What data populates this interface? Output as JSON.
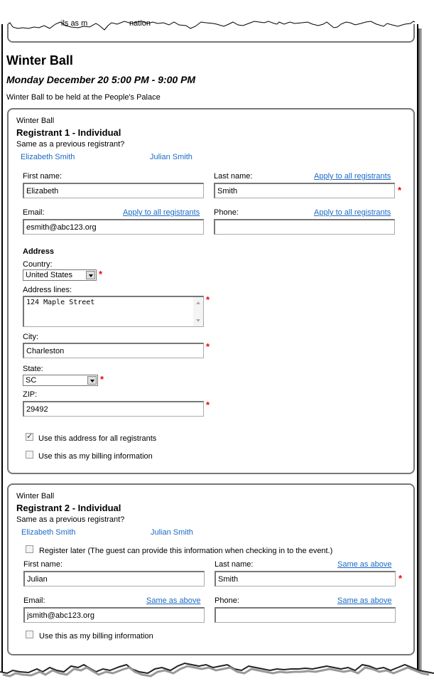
{
  "prev_fragment": {
    "text_a": "ils as m",
    "text_b": "nation"
  },
  "event": {
    "title": "Winter Ball",
    "datetime": "Monday  December 20 5:00 PM - 9:00 PM",
    "description": "Winter Ball to be held at the People's Palace"
  },
  "registrant1": {
    "event_name": "Winter Ball",
    "heading": "Registrant 1 - Individual",
    "same_prompt": "Same as a previous registrant?",
    "prev_links": [
      "Elizabeth Smith",
      "Julian Smith"
    ],
    "first_name_label": "First name:",
    "first_name_value": "Elizabeth",
    "last_name_label": "Last name:",
    "last_name_link": "Apply to all registrants",
    "last_name_value": "Smith",
    "email_label": "Email:",
    "email_link": "Apply to all registrants",
    "email_value": "esmith@abc123.org",
    "phone_label": "Phone:",
    "phone_link": "Apply to all registrants",
    "phone_value": "",
    "address_heading": "Address",
    "country_label": "Country:",
    "country_value": "United States",
    "address_lines_label": "Address lines:",
    "address_lines_value": "124 Maple Street",
    "city_label": "City:",
    "city_value": "Charleston",
    "state_label": "State:",
    "state_value": "SC",
    "zip_label": "ZIP:",
    "zip_value": "29492",
    "use_address_all": {
      "label": "Use this address for all registrants",
      "checked": true
    },
    "use_billing": {
      "label": "Use this as my billing information",
      "checked": false
    },
    "required_mark": "*"
  },
  "registrant2": {
    "event_name": "Winter Ball",
    "heading": "Registrant 2 - Individual",
    "same_prompt": "Same as a previous registrant?",
    "prev_links": [
      "Elizabeth Smith",
      "Julian Smith"
    ],
    "register_later": {
      "label": "Register later (The guest can provide this information when checking in to the event.)",
      "checked": false
    },
    "first_name_label": "First name:",
    "first_name_value": "Julian",
    "last_name_label": "Last name:",
    "last_name_link": "Same as above",
    "last_name_value": "Smith",
    "email_label": "Email:",
    "email_link": "Same as above",
    "email_value": "jsmith@abc123.org",
    "phone_label": "Phone:",
    "phone_link": "Same as above",
    "phone_value": "",
    "use_billing": {
      "label": "Use this as my billing information",
      "checked": false
    },
    "required_mark": "*"
  }
}
